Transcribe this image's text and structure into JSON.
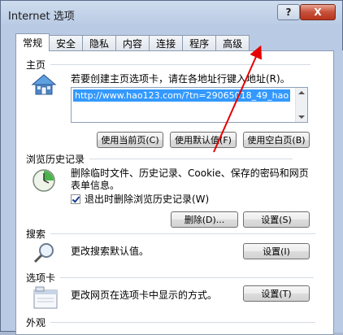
{
  "window": {
    "title": "Internet 选项",
    "help_label": "?",
    "close_label": "X"
  },
  "tabs": [
    {
      "label": "常规",
      "active": true
    },
    {
      "label": "安全"
    },
    {
      "label": "隐私"
    },
    {
      "label": "内容"
    },
    {
      "label": "连接"
    },
    {
      "label": "程序"
    },
    {
      "label": "高级"
    }
  ],
  "home": {
    "section_title": "主页",
    "description": "若要创建主页选项卡，请在各地址行键入地址(R)。",
    "url_value": "http://www.hao123.com/?tn=29065018_49_hao",
    "btn_current": "使用当前页(C)",
    "btn_default": "使用默认值(F)",
    "btn_blank": "使用空白页(B)"
  },
  "history": {
    "section_title": "浏览历史记录",
    "description_line1": "删除临时文件、历史记录、Cookie、保存的密码和网页",
    "description_line2": "表单信息。",
    "checkbox_label": "退出时删除浏览历史记录(W)",
    "checkbox_checked": true,
    "btn_delete": "删除(D)...",
    "btn_settings": "设置(S)"
  },
  "search": {
    "section_title": "搜索",
    "description": "更改搜索默认值。",
    "btn_settings": "设置(I)"
  },
  "tabsec": {
    "section_title": "选项卡",
    "description": "更改网页在选项卡中显示的方式。",
    "btn_settings": "设置(T)"
  },
  "appearance": {
    "section_title": "外观"
  },
  "colors": {
    "selection": "#3399ff",
    "arrow": "#e60000"
  }
}
